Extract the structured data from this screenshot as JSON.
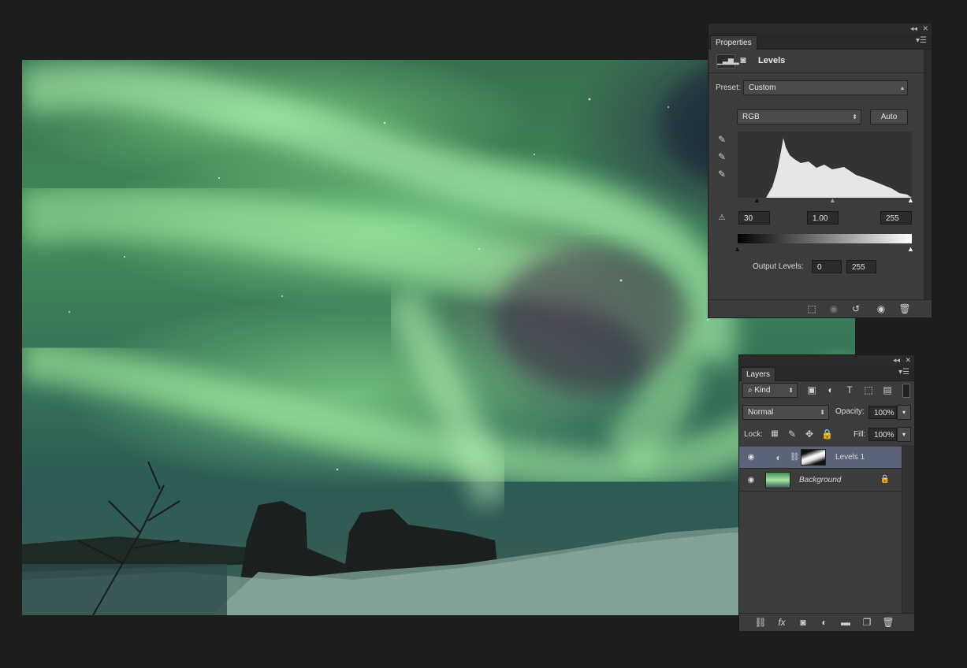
{
  "properties": {
    "tab": "Properties",
    "header_title": "Levels",
    "preset_label": "Preset:",
    "preset_value": "Custom",
    "channel_value": "RGB",
    "auto_label": "Auto",
    "input_black": "30",
    "input_gamma": "1.00",
    "input_white": "255",
    "output_label": "Output Levels:",
    "output_black": "0",
    "output_white": "255"
  },
  "layers": {
    "tab": "Layers",
    "filter_kind": "Kind",
    "blend_mode": "Normal",
    "opacity_label": "Opacity:",
    "opacity_value": "100%",
    "lock_label": "Lock:",
    "fill_label": "Fill:",
    "fill_value": "100%",
    "items": [
      {
        "name": "Levels 1",
        "selected": true
      },
      {
        "name": "Background",
        "selected": false
      }
    ]
  },
  "colors": {
    "app_bg": "#1d1d1d",
    "panel_bg": "#3c3c3c",
    "selected_layer": "#5b6378"
  },
  "icons": {
    "collapse": "double-chevron-left-icon",
    "close": "close-icon",
    "panel_menu": "panel-menu-icon",
    "eyedroppers": [
      "black-eyedropper-icon",
      "gray-eyedropper-icon",
      "white-eyedropper-icon"
    ],
    "layers_bottom": [
      "link-icon",
      "fx-icon",
      "mask-icon",
      "adjustment-icon",
      "folder-icon",
      "new-layer-icon",
      "trash-icon"
    ]
  }
}
